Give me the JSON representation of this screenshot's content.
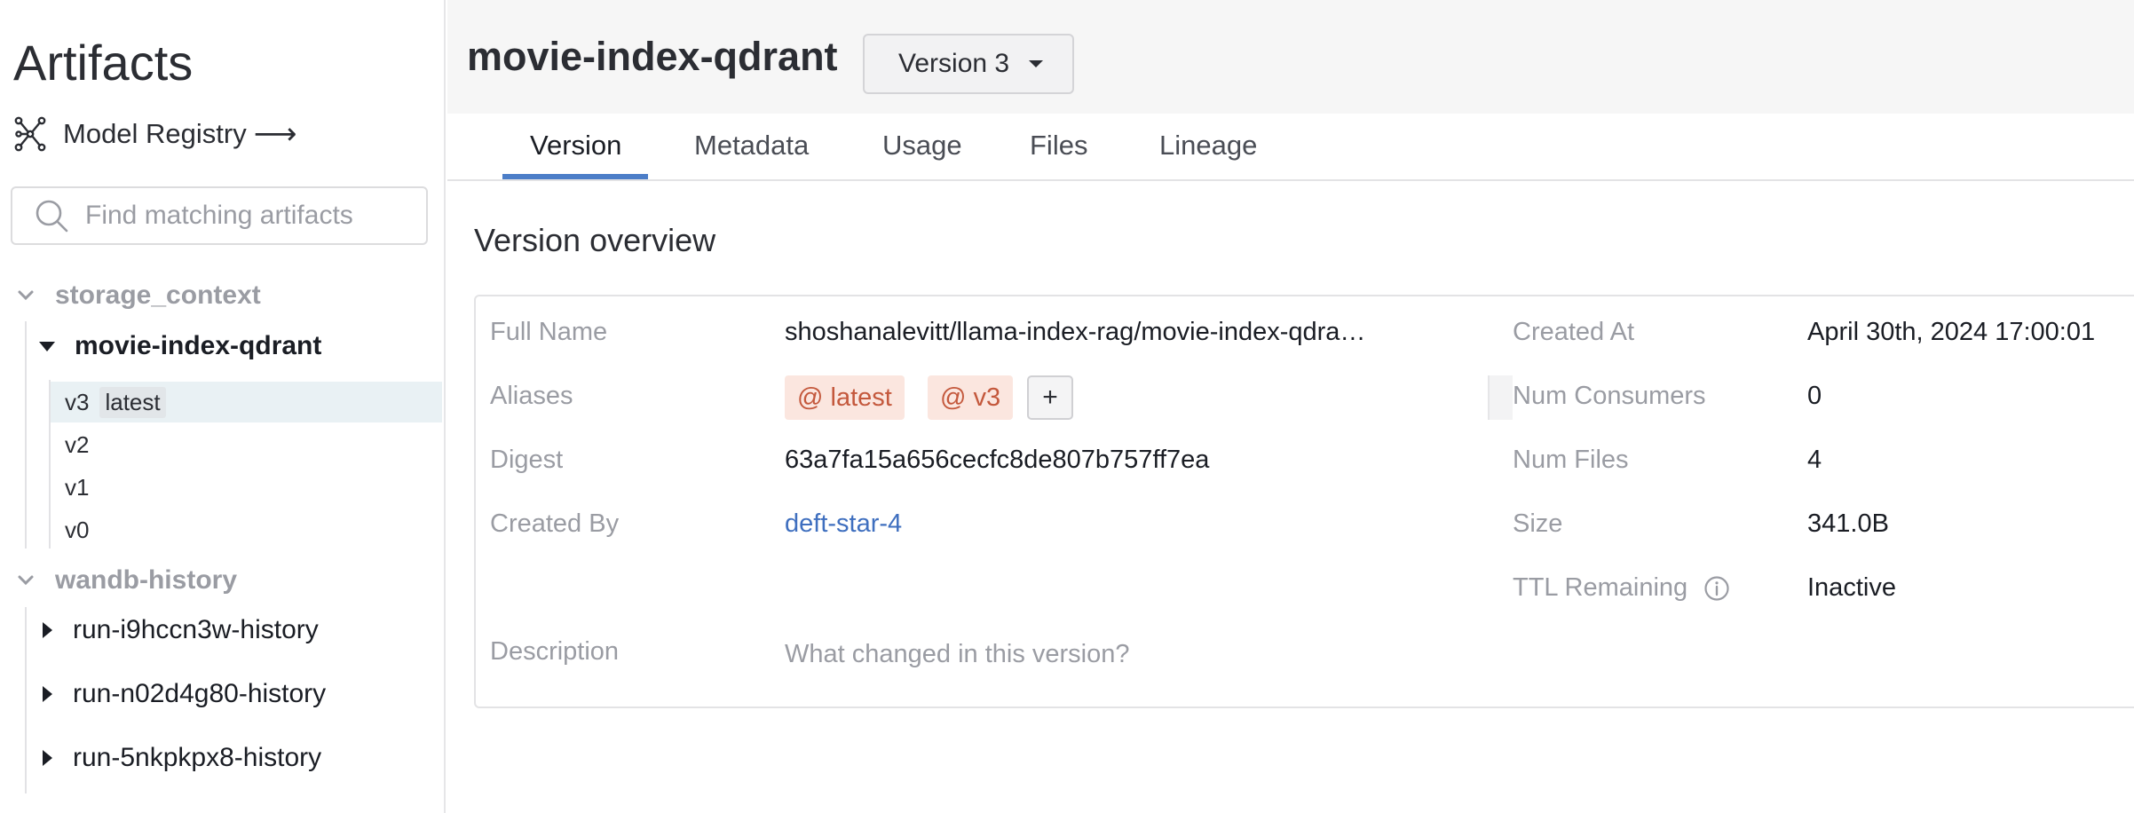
{
  "sidebar": {
    "title": "Artifacts",
    "model_registry_label": "Model Registry",
    "model_registry_arrow": "⟶",
    "search_placeholder": "Find matching artifacts",
    "groups": [
      {
        "name": "storage_context",
        "artifacts": [
          {
            "name": "movie-index-qdrant",
            "expanded": true,
            "versions": [
              {
                "label": "v3",
                "tag": "latest",
                "selected": true
              },
              {
                "label": "v2"
              },
              {
                "label": "v1"
              },
              {
                "label": "v0"
              }
            ]
          }
        ]
      },
      {
        "name": "wandb-history",
        "artifacts": [
          {
            "name": "run-i9hccn3w-history"
          },
          {
            "name": "run-n02d4g80-history"
          },
          {
            "name": "run-5nkpkpx8-history"
          }
        ]
      }
    ]
  },
  "header": {
    "title": "movie-index-qdrant",
    "version_select": "Version 3"
  },
  "tabs": [
    "Version",
    "Metadata",
    "Usage",
    "Files",
    "Lineage"
  ],
  "overview": {
    "title": "Version overview",
    "full_name_label": "Full Name",
    "full_name": "shoshanalevitt/llama-index-rag/movie-index-qdra…",
    "aliases_label": "Aliases",
    "aliases": [
      "@ latest",
      "@ v3"
    ],
    "add_alias": "+",
    "digest_label": "Digest",
    "digest": "63a7fa15a656cecfc8de807b757ff7ea",
    "created_by_label": "Created By",
    "created_by": "deft-star-4",
    "description_label": "Description",
    "description_placeholder": "What changed in this version?",
    "created_at_label": "Created At",
    "created_at": "April 30th, 2024 17:00:01",
    "num_consumers_label": "Num Consumers",
    "num_consumers": "0",
    "num_files_label": "Num Files",
    "num_files": "4",
    "size_label": "Size",
    "size": "341.0B",
    "ttl_label": "TTL Remaining",
    "ttl": "Inactive"
  },
  "colors": {
    "accent": "#4c7ec8",
    "alias_bg": "#fbe6df",
    "alias_text": "#c4583c",
    "link": "#3f6fbf"
  }
}
